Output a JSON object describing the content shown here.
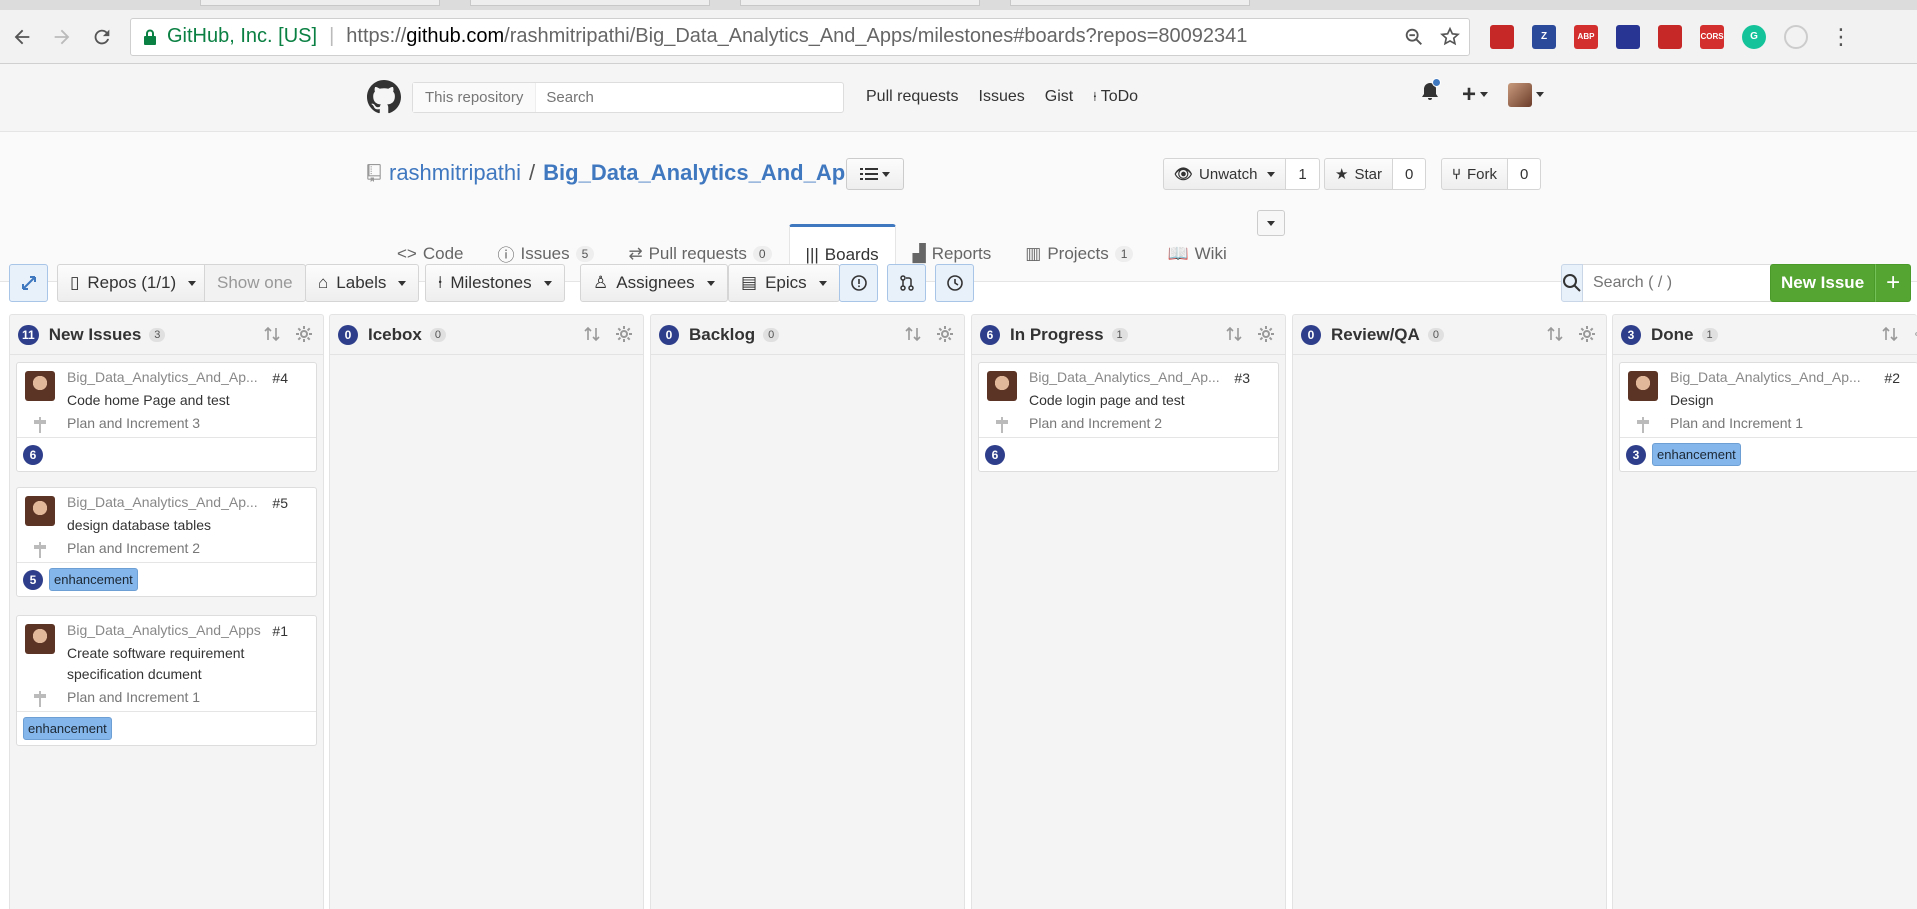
{
  "browser": {
    "secure_label": "GitHub, Inc. [US]",
    "url_scheme": "https://",
    "url_host": "github.com",
    "url_rest": "/rashmitripathi/Big_Data_Analytics_And_Apps/milestones#boards?repos=80092341",
    "extensions": [
      {
        "name": "shield-ext-icon",
        "text": "",
        "color": "#c62828"
      },
      {
        "name": "zotero-ext-icon",
        "text": "Z",
        "color": "#2c4a9a"
      },
      {
        "name": "adblock-ext-icon",
        "text": "ABP",
        "color": "#d32f2f"
      },
      {
        "name": "flag-ext-icon",
        "text": "",
        "color": "#283593"
      },
      {
        "name": "book-ext-icon",
        "text": "",
        "color": "#c62828"
      },
      {
        "name": "cors-ext-icon",
        "text": "CORS",
        "color": "#d32f2f"
      },
      {
        "name": "grammarly-ext-icon",
        "text": "G",
        "color": "#15c39a"
      },
      {
        "name": "hidden-ext-icon",
        "text": "",
        "color": "#cccccc"
      }
    ]
  },
  "gh_header": {
    "search_scope": "This repository",
    "search_placeholder": "Search",
    "nav": [
      "Pull requests",
      "Issues",
      "Gist",
      "ToDo"
    ]
  },
  "repo": {
    "owner": "rashmitripathi",
    "separator": "/",
    "name": "Big_Data_Analytics_And_Apps",
    "watch_label": "Unwatch",
    "watch_count": "1",
    "star_label": "Star",
    "star_count": "0",
    "fork_label": "Fork",
    "fork_count": "0",
    "tabs": [
      {
        "label": "Code",
        "count": ""
      },
      {
        "label": "Issues",
        "count": "5"
      },
      {
        "label": "Pull requests",
        "count": "0"
      },
      {
        "label": "Boards",
        "count": ""
      },
      {
        "label": "Reports",
        "count": ""
      },
      {
        "label": "Projects",
        "count": "1"
      },
      {
        "label": "Wiki",
        "count": ""
      }
    ]
  },
  "toolbar": {
    "repos_label": "Repos (1/1)",
    "show_one_label": "Show one",
    "labels_label": "Labels",
    "milestones_label": "Milestones",
    "assignees_label": "Assignees",
    "epics_label": "Epics",
    "search_placeholder": "Search ( / )",
    "new_issue_label": "New Issue",
    "new_issue_plus": "+"
  },
  "columns": [
    {
      "title": "New Issues",
      "points": "11",
      "issues": "3"
    },
    {
      "title": "Icebox",
      "points": "0",
      "issues": "0"
    },
    {
      "title": "Backlog",
      "points": "0",
      "issues": "0"
    },
    {
      "title": "In Progress",
      "points": "6",
      "issues": "1"
    },
    {
      "title": "Review/QA",
      "points": "0",
      "issues": "0"
    },
    {
      "title": "Done",
      "points": "3",
      "issues": "1"
    }
  ],
  "cards": {
    "c4": {
      "repo": "Big_Data_Analytics_And_Ap...",
      "num": "#4",
      "title": "Code home Page and test",
      "milestone": "Plan and Increment 3",
      "estimate": "6",
      "label": ""
    },
    "c5": {
      "repo": "Big_Data_Analytics_And_Ap...",
      "num": "#5",
      "title": "design database tables",
      "milestone": "Plan and Increment 2",
      "estimate": "5",
      "label": "enhancement"
    },
    "c1": {
      "repo": "Big_Data_Analytics_And_Apps",
      "num": "#1",
      "title": "Create software requirement specification dcument",
      "milestone": "Plan and Increment 1",
      "estimate": "",
      "label": "enhancement"
    },
    "c3": {
      "repo": "Big_Data_Analytics_And_Ap...",
      "num": "#3",
      "title": "Code login page and test",
      "milestone": "Plan and Increment 2",
      "estimate": "6",
      "label": ""
    },
    "c2": {
      "repo": "Big_Data_Analytics_And_Ap...",
      "num": "#2",
      "title": "Design",
      "milestone": "Plan and Increment 1",
      "estimate": "3",
      "label": "enhancement"
    }
  },
  "colors": {
    "accent_blue": "#4078c0",
    "estimate_badge": "#2e3e8a",
    "label_enhancement": "#84b6eb",
    "new_issue_green": "#55a532"
  }
}
